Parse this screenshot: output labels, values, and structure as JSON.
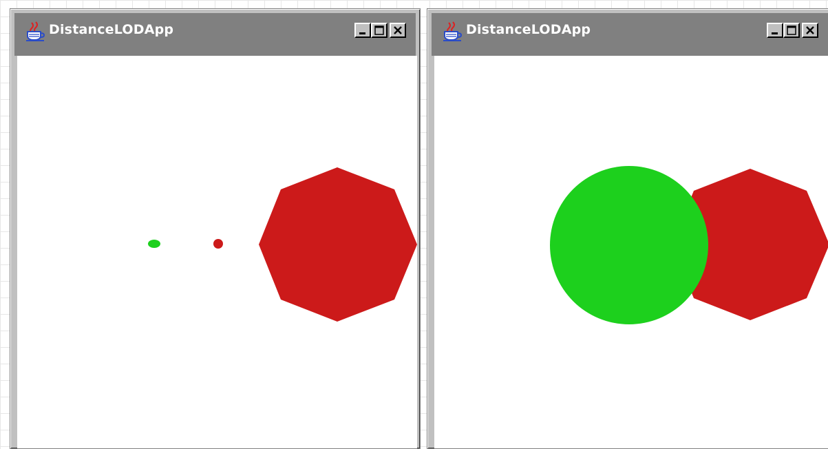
{
  "windows": [
    {
      "id": "left",
      "title": "DistanceLODApp",
      "scene": {
        "description_shape_colors": {
          "green": "#1dd01d",
          "red": "#cc1a1a"
        }
      }
    },
    {
      "id": "right",
      "title": "DistanceLODApp",
      "scene": {
        "description_shape_colors": {
          "green": "#1dd01d",
          "red": "#cc1a1a"
        }
      }
    }
  ],
  "colors": {
    "titlebar": "#808080",
    "client_bg": "#ffffff",
    "green": "#1dd01d",
    "red": "#cc1a1a"
  },
  "icons": [
    "java-coffee-cup-icon",
    "minimize-icon",
    "maximize-icon",
    "close-icon"
  ]
}
